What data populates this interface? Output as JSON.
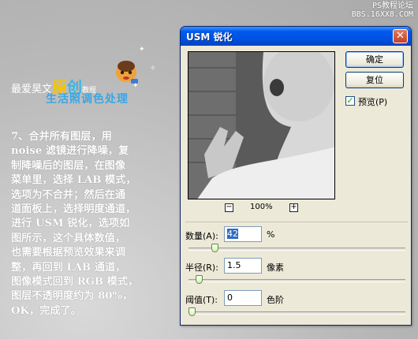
{
  "watermark": {
    "line1": "PS教程论坛",
    "line2": "BBS.16XX8.COM"
  },
  "brand": {
    "prefix": "最爱昊文",
    "hl1": "原",
    "hl2": "创",
    "suffix": "教程",
    "subtitle": "生活照调色处理"
  },
  "tutorial_text": "7、合并所有图层，用\nnoise 滤镜进行降噪，复\n制降噪后的图层，在图像\n菜单里，选择 LAB 模式，\n选项为不合并；然后在通\n道面板上，选择明度通道，\n进行 USM 锐化，选项如\n图所示，这个具体数值，\n也需要根据预览效果来调\n整，再回到 LAB 通道，\n图像模式回到 RGB 模式，\n图层不透明度约为 80%，\nOK，完成了。",
  "dialog": {
    "title": "USM 锐化",
    "close_glyph": "✕",
    "ok_label": "确定",
    "reset_label": "复位",
    "preview_label": "预览(P)",
    "preview_checked": true,
    "zoom_out_glyph": "−",
    "zoom_in_glyph": "+",
    "zoom_level": "100%",
    "amount": {
      "label": "数量(A):",
      "value": "42",
      "unit": "%",
      "slider_fraction": 0.11
    },
    "radius": {
      "label": "半径(R):",
      "value": "1.5",
      "unit": "像素",
      "slider_fraction": 0.035
    },
    "threshold": {
      "label": "阈值(T):",
      "value": "0",
      "unit": "色阶",
      "slider_fraction": 0.0
    }
  },
  "colors": {
    "titlebar": "#0054e3",
    "accent": "#316ac5",
    "brand_blue": "#3aa6e6",
    "brand_yellow": "#f6c400"
  },
  "icons": {
    "close": "close-icon",
    "checkbox": "checkmark-icon",
    "zoom_out": "minus-icon",
    "zoom_in": "plus-icon"
  }
}
